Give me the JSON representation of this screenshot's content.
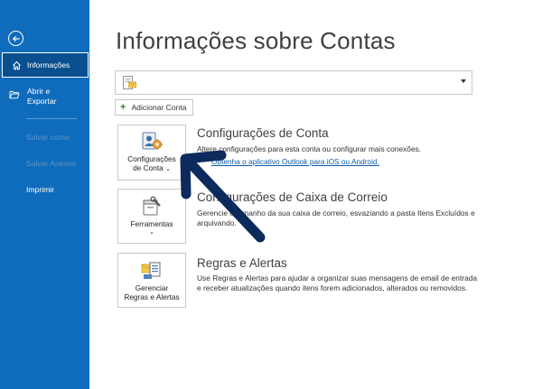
{
  "sidebar": {
    "items": [
      {
        "label": "Informações"
      },
      {
        "label": "Abrir e Exportar"
      },
      {
        "label": "Salvar como"
      },
      {
        "label": "Salvar Anexos"
      },
      {
        "label": "Imprimir"
      }
    ]
  },
  "main": {
    "title": "Informações sobre Contas",
    "add_account_label": "Adicionar Conta",
    "sections": [
      {
        "tile_label_1": "Configurações",
        "tile_label_2": "de Conta",
        "title": "Configurações de Conta",
        "description": "Altere configurações para esta conta ou configurar mais conexões.",
        "link": "Obtenha o aplicativo Outlook para iOS ou Android."
      },
      {
        "tile_label_1": "Ferramentas",
        "title": "Configurações de Caixa de Correio",
        "description": "Gerencie o tamanho da sua caixa de correio, esvaziando a pasta Itens Excluídos e arquivando."
      },
      {
        "tile_label_1": "Gerenciar",
        "tile_label_2": "Regras e Alertas",
        "title": "Regras e Alertas",
        "description": "Use Regras e Alertas para ajudar a organizar suas mensagens de email de entrada e receber atualizações quando itens forem adicionados, alterados ou removidos."
      }
    ]
  },
  "colors": {
    "sidebar_bg": "#0f6cbd",
    "sidebar_active_bg": "#0a4f8f",
    "arrow": "#0d2a5c",
    "link": "#0b5cad"
  },
  "icons": [
    "back-arrow-icon",
    "home-icon",
    "folder-open-icon",
    "account-icon",
    "account-settings-icon",
    "tools-icon",
    "rules-alerts-icon",
    "plus-icon",
    "chevron-down-icon"
  ]
}
